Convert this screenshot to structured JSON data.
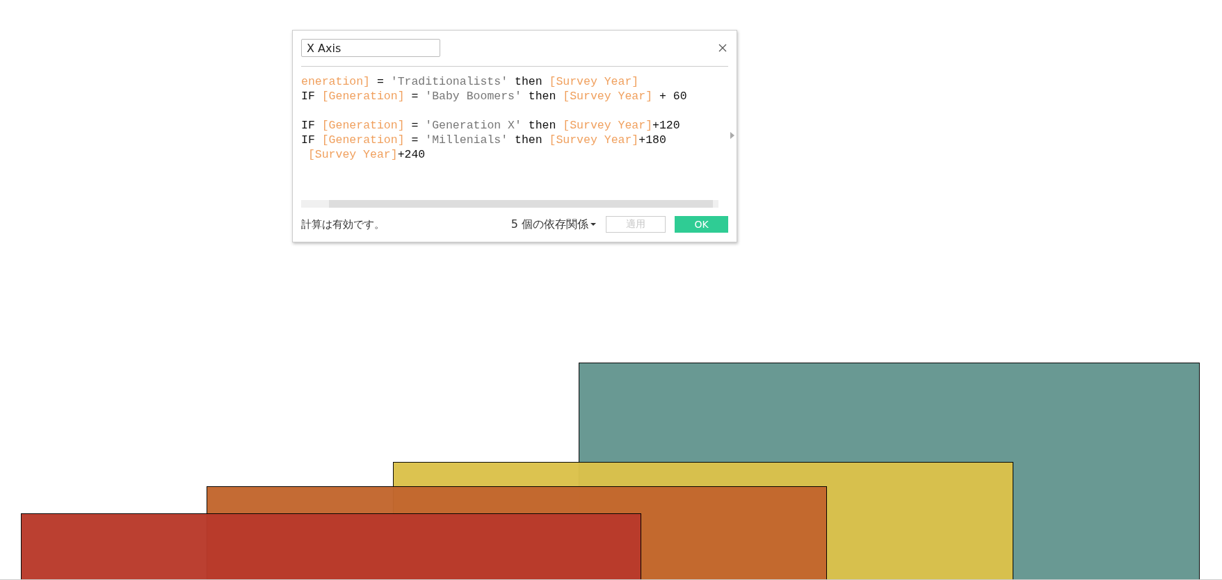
{
  "dialog": {
    "name_field": {
      "value": "X Axis"
    },
    "code_lines": [
      {
        "kind": "code",
        "tokens": [
          {
            "kind": "field",
            "text": "eneration]"
          },
          {
            "kind": "plain",
            "text": " = "
          },
          {
            "kind": "string",
            "text": "'Traditionalists'"
          },
          {
            "kind": "plain",
            "text": " then "
          },
          {
            "kind": "field",
            "text": "[Survey Year]"
          }
        ]
      },
      {
        "kind": "code",
        "tokens": [
          {
            "kind": "plain",
            "text": "IF "
          },
          {
            "kind": "field",
            "text": "[Generation]"
          },
          {
            "kind": "plain",
            "text": " = "
          },
          {
            "kind": "string",
            "text": "'Baby Boomers'"
          },
          {
            "kind": "plain",
            "text": " then "
          },
          {
            "kind": "field",
            "text": "[Survey Year]"
          },
          {
            "kind": "plain",
            "text": " + 60"
          }
        ]
      },
      {
        "kind": "blank"
      },
      {
        "kind": "code",
        "tokens": [
          {
            "kind": "plain",
            "text": "IF "
          },
          {
            "kind": "field",
            "text": "[Generation]"
          },
          {
            "kind": "plain",
            "text": " = "
          },
          {
            "kind": "string",
            "text": "'Generation X'"
          },
          {
            "kind": "plain",
            "text": " then "
          },
          {
            "kind": "field",
            "text": "[Survey Year]"
          },
          {
            "kind": "plain",
            "text": "+120"
          }
        ]
      },
      {
        "kind": "code",
        "tokens": [
          {
            "kind": "plain",
            "text": "IF "
          },
          {
            "kind": "field",
            "text": "[Generation]"
          },
          {
            "kind": "plain",
            "text": " = "
          },
          {
            "kind": "string",
            "text": "'Millenials'"
          },
          {
            "kind": "plain",
            "text": " then "
          },
          {
            "kind": "field",
            "text": "[Survey Year]"
          },
          {
            "kind": "plain",
            "text": "+180"
          }
        ]
      },
      {
        "kind": "code",
        "tokens": [
          {
            "kind": "field",
            "text": " [Survey Year]"
          },
          {
            "kind": "plain",
            "text": "+240"
          }
        ]
      }
    ],
    "status": "計算は有効です。",
    "dependencies": "5 個の依存関係",
    "buttons": [
      {
        "label": "適用",
        "disabled": true
      },
      {
        "label": "OK",
        "disabled": false
      }
    ]
  },
  "shapes": [
    {
      "color": "#659690"
    },
    {
      "color": "#dbc24b"
    },
    {
      "color": "#c3672e"
    },
    {
      "color": "#b93a2b"
    }
  ]
}
